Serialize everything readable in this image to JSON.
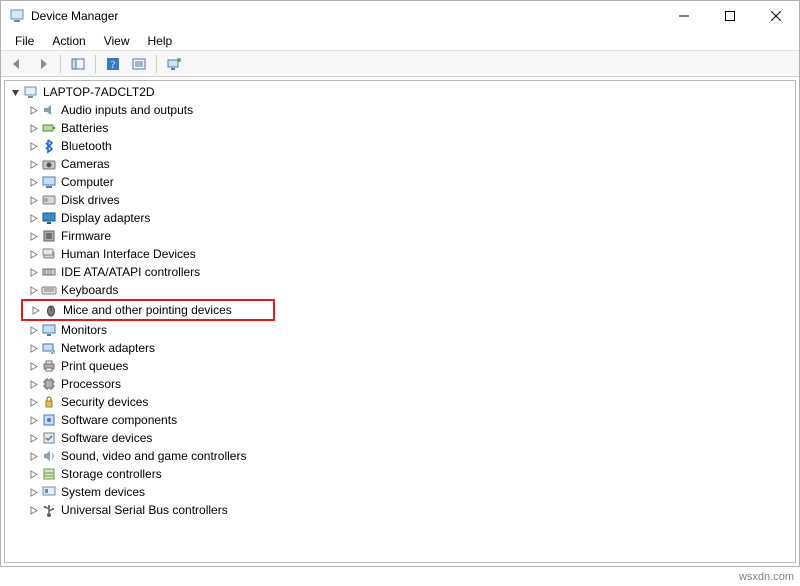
{
  "window": {
    "title": "Device Manager"
  },
  "menu": {
    "file": "File",
    "action": "Action",
    "view": "View",
    "help": "Help"
  },
  "tree": {
    "root": "LAPTOP-7ADCLT2D",
    "categories": [
      {
        "label": "Audio inputs and outputs",
        "icon": "audio"
      },
      {
        "label": "Batteries",
        "icon": "battery"
      },
      {
        "label": "Bluetooth",
        "icon": "bluetooth"
      },
      {
        "label": "Cameras",
        "icon": "camera"
      },
      {
        "label": "Computer",
        "icon": "computer"
      },
      {
        "label": "Disk drives",
        "icon": "disk"
      },
      {
        "label": "Display adapters",
        "icon": "display"
      },
      {
        "label": "Firmware",
        "icon": "firmware"
      },
      {
        "label": "Human Interface Devices",
        "icon": "hid"
      },
      {
        "label": "IDE ATA/ATAPI controllers",
        "icon": "ide"
      },
      {
        "label": "Keyboards",
        "icon": "keyboard"
      },
      {
        "label": "Mice and other pointing devices",
        "icon": "mouse",
        "highlight": true
      },
      {
        "label": "Monitors",
        "icon": "monitor"
      },
      {
        "label": "Network adapters",
        "icon": "network"
      },
      {
        "label": "Print queues",
        "icon": "printer"
      },
      {
        "label": "Processors",
        "icon": "cpu"
      },
      {
        "label": "Security devices",
        "icon": "security"
      },
      {
        "label": "Software components",
        "icon": "swcomp"
      },
      {
        "label": "Software devices",
        "icon": "swdev"
      },
      {
        "label": "Sound, video and game controllers",
        "icon": "sound"
      },
      {
        "label": "Storage controllers",
        "icon": "storage"
      },
      {
        "label": "System devices",
        "icon": "system"
      },
      {
        "label": "Universal Serial Bus controllers",
        "icon": "usb"
      }
    ]
  },
  "watermark": "wsxdn.com"
}
